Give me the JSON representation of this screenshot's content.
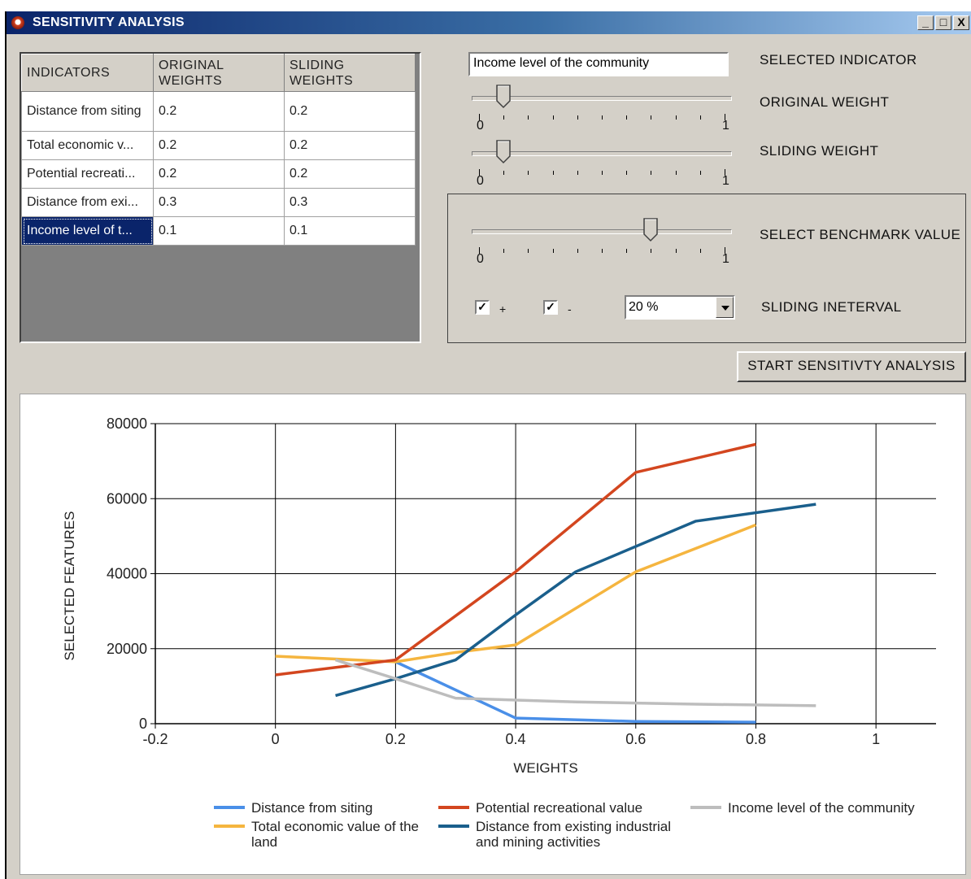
{
  "window": {
    "title": "SENSITIVITY ANALYSIS",
    "controls": [
      "_",
      "□",
      "X"
    ]
  },
  "grid": {
    "headers": [
      "INDICATORS",
      "ORIGINAL WEIGHTS",
      "SLIDING WEIGHTS"
    ],
    "header_lines": [
      [
        "INDICATORS"
      ],
      [
        "ORIGINAL",
        "WEIGHTS"
      ],
      [
        "SLIDING",
        "WEIGHTS"
      ]
    ],
    "rows": [
      [
        "Distance from siting",
        "0.2",
        "0.2"
      ],
      [
        "Total economic v...",
        "0.2",
        "0.2"
      ],
      [
        "Potential recreati...",
        "0.2",
        "0.2"
      ],
      [
        "Distance from exi...",
        "0.3",
        "0.3"
      ],
      [
        "Income level of t...",
        "0.1",
        "0.1"
      ]
    ],
    "selected_row": 4
  },
  "selected_indicator": {
    "value": "Income level of the community",
    "label": "SELECTED INDICATOR"
  },
  "original_weight": {
    "label": "ORIGINAL WEIGHT",
    "min": "0",
    "max": "1",
    "value": 0.1
  },
  "sliding_weight": {
    "label": "SLIDING WEIGHT",
    "min": "0",
    "max": "1",
    "value": 0.1
  },
  "benchmark": {
    "label": "SELECT BENCHMARK VALUE",
    "min": "0",
    "max": "1",
    "value": 0.7
  },
  "sliding_interval": {
    "label": "SLIDING INETERVAL",
    "plus": {
      "label": "+",
      "checked": true
    },
    "minus": {
      "label": "-",
      "checked": true
    },
    "selected": "20 %"
  },
  "start_button": "START SENSITIVTY ANALYSIS",
  "colors": {
    "title_bar": "#0a246a",
    "selection": "#0a246a",
    "series": [
      "#4a8fe8",
      "#f5b53f",
      "#d3461f",
      "#1a5f8c",
      "#bdbdbd"
    ]
  },
  "chart_data": {
    "type": "line",
    "title": "",
    "xlabel": "WEIGHTS",
    "ylabel": "SELECTED FEATURES",
    "xlim": [
      -0.2,
      1.1
    ],
    "ylim": [
      0,
      80000
    ],
    "xticks": [
      "-0.2",
      "0",
      "0.2",
      "0.4",
      "0.6",
      "0.8",
      "1"
    ],
    "yticks": [
      "0",
      "20000",
      "40000",
      "60000",
      "80000"
    ],
    "grid": true,
    "legend_position": "bottom",
    "series": [
      {
        "name": "Distance from siting",
        "x": [
          0.2,
          0.4,
          0.6,
          0.8
        ],
        "y": [
          16500,
          1500,
          600,
          400
        ]
      },
      {
        "name": "Total economic value of the land",
        "x": [
          0,
          0.2,
          0.3,
          0.4,
          0.6,
          0.8
        ],
        "y": [
          18000,
          16500,
          19000,
          21000,
          40500,
          53000
        ]
      },
      {
        "name": "Potential recreational value",
        "x": [
          0,
          0.2,
          0.4,
          0.6,
          0.8
        ],
        "y": [
          13000,
          17000,
          40500,
          67000,
          74500
        ]
      },
      {
        "name": "Distance from existing industrial and mining activities",
        "x": [
          0.1,
          0.2,
          0.3,
          0.4,
          0.5,
          0.7,
          0.9
        ],
        "y": [
          7500,
          12000,
          17000,
          29000,
          40500,
          54000,
          58500
        ]
      },
      {
        "name": "Income level of the community",
        "x": [
          0.1,
          0.2,
          0.3,
          0.5,
          0.7,
          0.9
        ],
        "y": [
          17000,
          12000,
          6800,
          5800,
          5200,
          4800
        ]
      }
    ]
  }
}
